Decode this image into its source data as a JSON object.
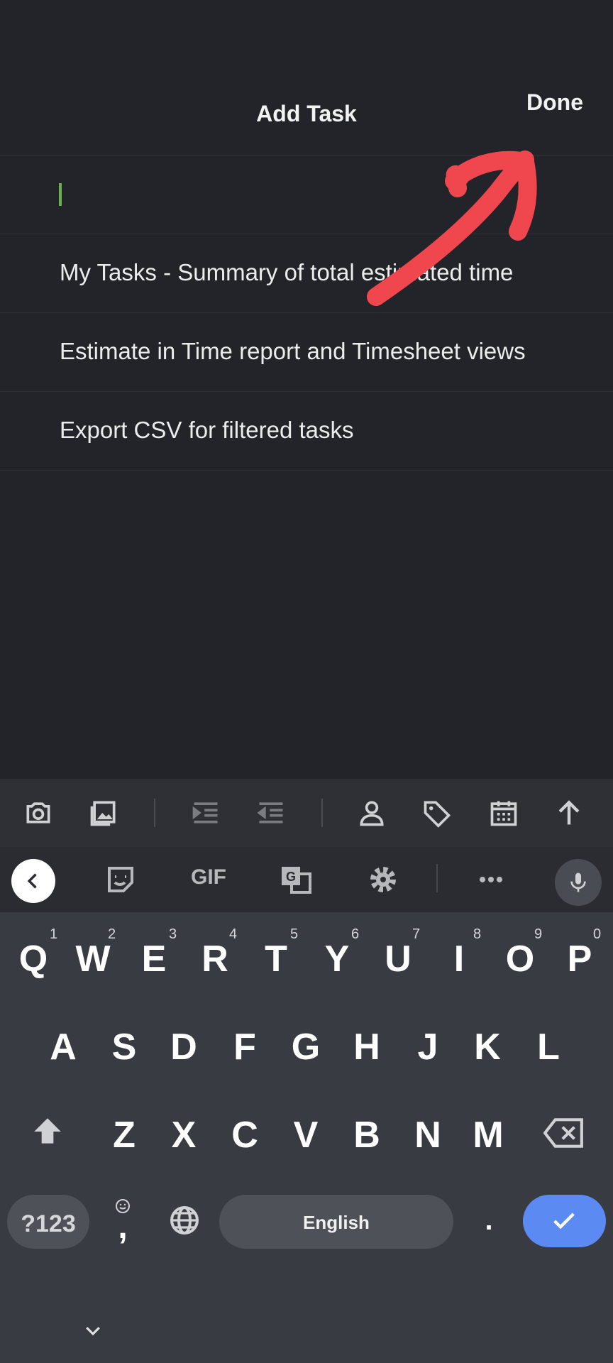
{
  "header": {
    "title": "Add Task",
    "done_label": "Done"
  },
  "task_input": {
    "value": ""
  },
  "suggestions": [
    {
      "text": "My Tasks - Summary of total estimated time"
    },
    {
      "text": "Estimate in Time report and Timesheet views"
    },
    {
      "text": "Export CSV for filtered tasks"
    }
  ],
  "keyboard": {
    "toolbar_icons": [
      "camera-icon",
      "image-icon",
      "indent-icon",
      "outdent-icon",
      "person-icon",
      "tag-icon",
      "calendar-icon",
      "arrow-up-icon"
    ],
    "suggestion_bar": {
      "gif_label": "GIF",
      "icons": [
        "back-chevron-icon",
        "sticker-icon",
        "gif-icon",
        "translate-icon",
        "settings-icon",
        "more-icon",
        "mic-icon"
      ]
    },
    "row1": [
      "Q",
      "W",
      "E",
      "R",
      "T",
      "Y",
      "U",
      "I",
      "O",
      "P"
    ],
    "row1_hints": [
      "1",
      "2",
      "3",
      "4",
      "5",
      "6",
      "7",
      "8",
      "9",
      "0"
    ],
    "row2": [
      "A",
      "S",
      "D",
      "F",
      "G",
      "H",
      "J",
      "K",
      "L"
    ],
    "row3": [
      "Z",
      "X",
      "C",
      "V",
      "B",
      "N",
      "M"
    ],
    "symbols_label": "?123",
    "comma_label": ",",
    "space_label": "English",
    "period_label": ".",
    "accent_color": "#5a8af2"
  },
  "annotation": {
    "color": "#f0474f",
    "type": "arrow pointing to Done"
  }
}
